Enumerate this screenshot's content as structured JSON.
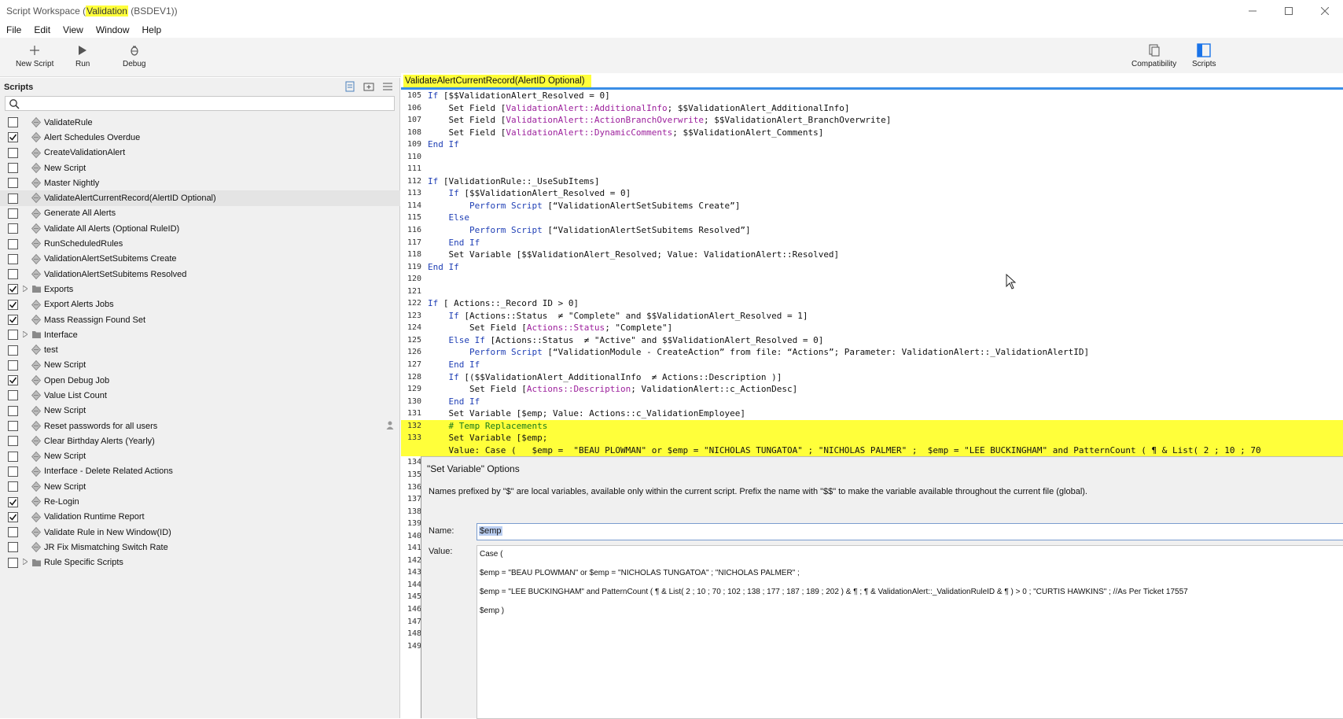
{
  "window": {
    "title_prefix": "Script Workspace (",
    "title_highlight": "Validation",
    "title_suffix": " (BSDEV1))"
  },
  "menu": [
    "File",
    "Edit",
    "View",
    "Window",
    "Help"
  ],
  "toolbar": {
    "new_script": "New Script",
    "run": "Run",
    "debug": "Debug",
    "compatibility": "Compatibility",
    "scripts": "Scripts"
  },
  "sidebar": {
    "header": "Scripts",
    "search_placeholder": "",
    "items": [
      {
        "label": "ValidateRule",
        "checked": false,
        "folder": false
      },
      {
        "label": "Alert Schedules Overdue",
        "checked": true,
        "folder": false
      },
      {
        "label": "CreateValidationAlert",
        "checked": false,
        "folder": false
      },
      {
        "label": "New Script",
        "checked": false,
        "folder": false
      },
      {
        "label": "Master Nightly",
        "checked": false,
        "folder": false
      },
      {
        "label": "ValidateAlertCurrentRecord(AlertID Optional)",
        "checked": false,
        "folder": false,
        "selected": true
      },
      {
        "label": "Generate All Alerts",
        "checked": false,
        "folder": false
      },
      {
        "label": "Validate All Alerts (Optional RuleID)",
        "checked": false,
        "folder": false
      },
      {
        "label": "RunScheduledRules",
        "checked": false,
        "folder": false
      },
      {
        "label": "ValidationAlertSetSubitems Create",
        "checked": false,
        "folder": false
      },
      {
        "label": "ValidationAlertSetSubitems Resolved",
        "checked": false,
        "folder": false
      },
      {
        "label": "Exports",
        "checked": true,
        "folder": true
      },
      {
        "label": "Export Alerts Jobs",
        "checked": true,
        "folder": false
      },
      {
        "label": "Mass Reassign Found Set",
        "checked": true,
        "folder": false
      },
      {
        "label": "Interface",
        "checked": false,
        "folder": true
      },
      {
        "label": "test",
        "checked": false,
        "folder": false
      },
      {
        "label": "New Script",
        "checked": false,
        "folder": false
      },
      {
        "label": "Open Debug Job",
        "checked": true,
        "folder": false
      },
      {
        "label": "Value List Count",
        "checked": false,
        "folder": false
      },
      {
        "label": "New Script",
        "checked": false,
        "folder": false
      },
      {
        "label": "Reset passwords for all users",
        "checked": false,
        "folder": false,
        "user": true
      },
      {
        "label": "Clear Birthday Alerts (Yearly)",
        "checked": false,
        "folder": false
      },
      {
        "label": "New Script",
        "checked": false,
        "folder": false
      },
      {
        "label": "Interface - Delete Related Actions",
        "checked": false,
        "folder": false
      },
      {
        "label": "New Script",
        "checked": false,
        "folder": false
      },
      {
        "label": "Re-Login",
        "checked": true,
        "folder": false
      },
      {
        "label": "Validation Runtime Report",
        "checked": true,
        "folder": false
      },
      {
        "label": "Validate Rule in New Window(ID)",
        "checked": false,
        "folder": false
      },
      {
        "label": "JR Fix Mismatching Switch Rate",
        "checked": false,
        "folder": false
      },
      {
        "label": "Rule Specific Scripts",
        "checked": false,
        "folder": true
      }
    ]
  },
  "editor": {
    "tab_title": "ValidateAlertCurrentRecord(AlertID Optional)",
    "lines": [
      {
        "n": "105",
        "html": "<span class=\"kw\">If</span> [$$ValidationAlert_Resolved = 0]"
      },
      {
        "n": "106",
        "html": "    Set Field [<span class=\"fld\">ValidationAlert::AdditionalInfo</span>; $$ValidationAlert_AdditionalInfo]"
      },
      {
        "n": "107",
        "html": "    Set Field [<span class=\"fld\">ValidationAlert::ActionBranchOverwrite</span>; $$ValidationAlert_BranchOverwrite]"
      },
      {
        "n": "108",
        "html": "    Set Field [<span class=\"fld\">ValidationAlert::DynamicComments</span>; $$ValidationAlert_Comments]"
      },
      {
        "n": "109",
        "html": "<span class=\"kw\">End If</span>"
      },
      {
        "n": "110",
        "html": ""
      },
      {
        "n": "111",
        "html": ""
      },
      {
        "n": "112",
        "html": "<span class=\"kw\">If</span> [ValidationRule::_UseSubItems]"
      },
      {
        "n": "113",
        "html": "    <span class=\"kw\">If</span> [$$ValidationAlert_Resolved = 0]"
      },
      {
        "n": "114",
        "html": "        <span class=\"kw\">Perform Script</span> [“ValidationAlertSetSubitems Create”]"
      },
      {
        "n": "115",
        "html": "    <span class=\"kw\">Else</span>"
      },
      {
        "n": "116",
        "html": "        <span class=\"kw\">Perform Script</span> [“ValidationAlertSetSubitems Resolved”]"
      },
      {
        "n": "117",
        "html": "    <span class=\"kw\">End If</span>"
      },
      {
        "n": "118",
        "html": "    Set Variable [$$ValidationAlert_Resolved; Value: ValidationAlert::Resolved]"
      },
      {
        "n": "119",
        "html": "<span class=\"kw\">End If</span>"
      },
      {
        "n": "120",
        "html": ""
      },
      {
        "n": "121",
        "html": ""
      },
      {
        "n": "122",
        "html": "<span class=\"kw\">If</span> [ Actions::_Record ID &gt; 0]"
      },
      {
        "n": "123",
        "html": "    <span class=\"kw\">If</span> [Actions::Status  ≠ \"Complete\" and $$ValidationAlert_Resolved = 1]"
      },
      {
        "n": "124",
        "html": "        Set Field [<span class=\"fld\">Actions::Status</span>; \"Complete\"]"
      },
      {
        "n": "125",
        "html": "    <span class=\"kw\">Else If</span> [Actions::Status  ≠ \"Active\" and $$ValidationAlert_Resolved = 0]"
      },
      {
        "n": "126",
        "html": "        <span class=\"kw\">Perform Script</span> [“ValidationModule - CreateAction” from file: “Actions”; Parameter: ValidationAlert::_ValidationAlertID]"
      },
      {
        "n": "127",
        "html": "    <span class=\"kw\">End If</span>"
      },
      {
        "n": "128",
        "html": "    <span class=\"kw\">If</span> [($$ValidationAlert_AdditionalInfo  ≠ Actions::Description )]"
      },
      {
        "n": "129",
        "html": "        Set Field [<span class=\"fld\">Actions::Description</span>; ValidationAlert::c_ActionDesc]"
      },
      {
        "n": "130",
        "html": "    <span class=\"kw\">End If</span>"
      },
      {
        "n": "131",
        "html": "    Set Variable [$emp; Value: Actions::c_ValidationEmployee]"
      },
      {
        "n": "132",
        "html": "    <span class=\"cmt\"># Temp Replacements</span>",
        "hl": true
      },
      {
        "n": "133",
        "html": "    Set Variable [$emp;",
        "hl": true
      },
      {
        "n": "",
        "html": "    Value: Case (   $emp =  \"BEAU PLOWMAN\" or $emp = \"NICHOLAS TUNGATOA\" ; \"NICHOLAS PALMER\" ;  $emp = \"LEE BUCKINGHAM\" and PatternCount ( ¶ &amp; List( 2 ; 10 ; 70",
        "hl": true
      }
    ],
    "gutter_numbers": [
      "134",
      "135",
      "136",
      "137",
      "138",
      "139",
      "140",
      "141",
      "142",
      "143",
      "144",
      "145",
      "146",
      "147",
      "148",
      "149"
    ]
  },
  "dialog": {
    "title": "\"Set Variable\" Options",
    "note": "Names prefixed by \"$\" are local variables, available only within the current script. Prefix the name with \"$$\" to make the variable available throughout the current file (global).",
    "name_label": "Name:",
    "name_value": "$emp",
    "value_label": "Value:",
    "value_lines": [
      "Case (",
      "$emp =  \"BEAU PLOWMAN\" or $emp = \"NICHOLAS TUNGATOA\" ; \"NICHOLAS PALMER\" ;",
      "$emp = \"LEE BUCKINGHAM\" and PatternCount ( ¶ & List( 2 ; 10 ; 70 ; 102 ; 138 ; 177 ; 187 ; 189 ; 202 ) & ¶ ; ¶ & ValidationAlert::_ValidationRuleID & ¶ ) > 0 ; \"CURTIS HAWKINS\" ; //As Per Ticket 17557",
      "$emp )"
    ]
  }
}
